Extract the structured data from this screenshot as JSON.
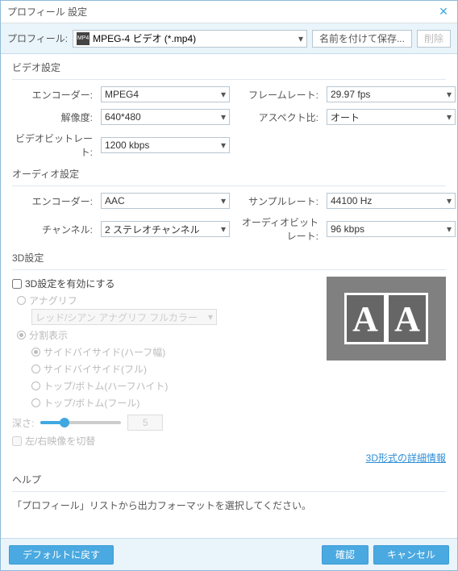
{
  "window": {
    "title": "プロフィール 設定"
  },
  "toolbar": {
    "profile_label": "プロフィール:",
    "profile_value": "MPEG-4 ビデオ (*.mp4)",
    "save_as": "名前を付けて保存...",
    "delete": "削除"
  },
  "video": {
    "group": "ビデオ設定",
    "encoder_label": "エンコーダー:",
    "encoder": "MPEG4",
    "resolution_label": "解像度:",
    "resolution": "640*480",
    "bitrate_label": "ビデオビットレート:",
    "bitrate": "1200 kbps",
    "framerate_label": "フレームレート:",
    "framerate": "29.97 fps",
    "aspect_label": "アスペクト比:",
    "aspect": "オート"
  },
  "audio": {
    "group": "オーディオ設定",
    "encoder_label": "エンコーダー:",
    "encoder": "AAC",
    "channel_label": "チャンネル:",
    "channel": "2 ステレオチャンネル",
    "samplerate_label": "サンプルレート:",
    "samplerate": "44100 Hz",
    "bitrate_label": "オーディオビットレート:",
    "bitrate": "96 kbps"
  },
  "d3": {
    "group": "3D設定",
    "enable": "3D設定を有効にする",
    "anaglyph": "アナグリフ",
    "anaglyph_mode": "レッド/シアン アナグリフ フルカラー",
    "split": "分割表示",
    "sbs_half": "サイドバイサイド(ハーフ幅)",
    "sbs_full": "サイドバイサイド(フル)",
    "tb_half": "トップ/ボトム(ハーフハイト)",
    "tb_full": "トップ/ボトム(フール)",
    "depth_label": "深さ:",
    "depth_value": "5",
    "swap": "左/右映像を切替",
    "info_link": "3D形式の詳細情報"
  },
  "help": {
    "group": "ヘルプ",
    "text": "「プロフィール」リストから出力フォーマットを選択してください。"
  },
  "footer": {
    "default": "デフォルトに戻す",
    "ok": "確認",
    "cancel": "キャンセル"
  }
}
